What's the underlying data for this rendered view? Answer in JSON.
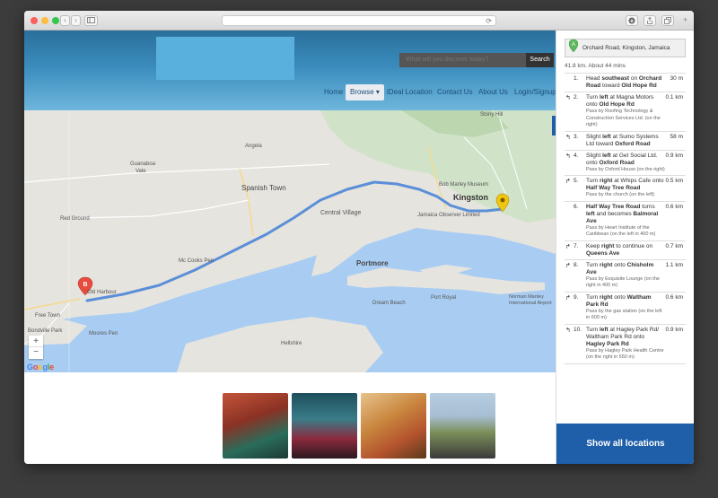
{
  "browser": {
    "url": "",
    "buttons": {
      "back": "‹",
      "forward": "›"
    }
  },
  "header": {
    "search_placeholder": "What will you discover today?",
    "search_button": "Search",
    "menu": [
      {
        "label": "Home"
      },
      {
        "label": "Browse ▾"
      },
      {
        "label": "iDeal Location"
      },
      {
        "label": "Contact Us"
      },
      {
        "label": "About Us"
      },
      {
        "label": "Login/Signup"
      }
    ]
  },
  "map": {
    "labels": {
      "stony_hill": "Stony Hill",
      "angela": "Angela",
      "guanaboa_vale": "Guanaboa Vale",
      "spanish_town": "Spanish Town",
      "bob_marley": "Bob Marley Museum",
      "kingston": "Kingston",
      "red_ground": "Red Ground",
      "central_village": "Central Village",
      "jamaica_observer": "Jamaica Observer Limited",
      "mc_cooks_pen": "Mc Cooks Pen",
      "portmore": "Portmore",
      "old_harbour": "Old Harbour",
      "free_town": "Free Town",
      "dream_beach": "Dream Beach",
      "port_royal": "Port Royal",
      "norman_manley": "Norman Manley International Airport",
      "moores_pen": "Moores Pen",
      "hellshire": "Hellshire",
      "bondville_park": "Bondville Park",
      "marker_b": "B",
      "zoom_in": "+",
      "zoom_out": "−",
      "google": "Google"
    }
  },
  "directions": {
    "marker": "A",
    "origin": "Orchard Road, Kingston, Jamaica",
    "summary": "41.8 km. About 44 mins",
    "show_all": "Show all locations",
    "steps": [
      {
        "turn": "",
        "num": "1.",
        "html": "Head <b>southeast</b> on <b>Orchard Road</b> toward <b>Old Hope Rd</b>",
        "sub": "",
        "dist": "30 m"
      },
      {
        "turn": "↰",
        "num": "2.",
        "html": "Turn <b>left</b> at Magna Motors onto <b>Old Hope Rd</b>",
        "sub": "Pass by Roofing Technology & Construction Services Ltd. (on the right)",
        "dist": "0.1 km"
      },
      {
        "turn": "↰",
        "num": "3.",
        "html": "Slight <b>left</b> at Sumo Systems Ltd toward <b>Oxford Road</b>",
        "sub": "",
        "dist": "58 m"
      },
      {
        "turn": "↰",
        "num": "4.",
        "html": "Slight <b>left</b> at Get Social Ltd. onto <b>Oxford Road</b>",
        "sub": "Pass by Oxford House (on the right)",
        "dist": "0.9 km"
      },
      {
        "turn": "↱",
        "num": "5.",
        "html": "Turn <b>right</b> at Whips Cafe onto <b>Half Way Tree Road</b>",
        "sub": "Pass by the church (on the left)",
        "dist": "0.5 km"
      },
      {
        "turn": "",
        "num": "6.",
        "html": "<b>Half Way Tree Road</b> turns <b>left</b> and becomes <b>Balmoral Ave</b>",
        "sub": "Pass by Heart Institute of the Caribbean (on the left in 400 m)",
        "dist": "0.6 km"
      },
      {
        "turn": "↱",
        "num": "7.",
        "html": "Keep <b>right</b> to continue on <b>Queens Ave</b>",
        "sub": "",
        "dist": "0.7 km"
      },
      {
        "turn": "↱",
        "num": "8.",
        "html": "Turn <b>right</b> onto <b>Chisholm Ave</b>",
        "sub": "Pass by Exquisite Lounge (on the right in 400 m)",
        "dist": "1.1 km"
      },
      {
        "turn": "↱",
        "num": "9.",
        "html": "Turn <b>right</b> onto <b>Waltham Park Rd</b>",
        "sub": "Pass by the gas station (on the left in 600 m)",
        "dist": "0.6 km"
      },
      {
        "turn": "↰",
        "num": "10.",
        "html": "Turn <b>left</b> at Hagley Park Rd/ Waltham Park Rd onto <b>Hagley Park Rd</b>",
        "sub": "Pass by Hagley Park Health Centre (on the right in 550 m)",
        "dist": "0.9 km"
      }
    ]
  }
}
